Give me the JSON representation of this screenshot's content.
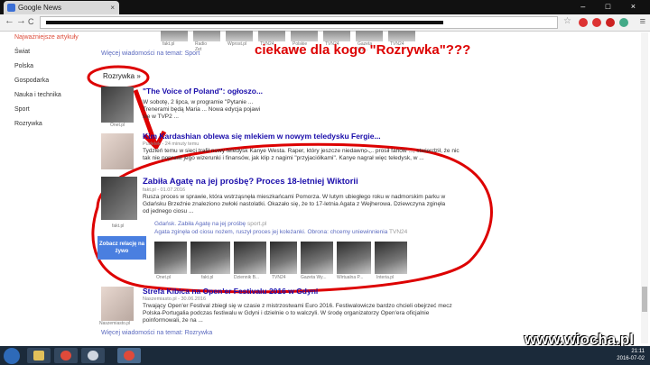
{
  "browser": {
    "tab_title": "Google News",
    "tab_close": "×",
    "window_controls": "– □ ×",
    "back": "←",
    "forward": "→",
    "reload": "C",
    "star": "☆",
    "menu": "≡"
  },
  "sidebar": {
    "items": [
      {
        "label": "Najważniejsze artykuły",
        "active": true
      },
      {
        "label": "Świat",
        "active": false
      },
      {
        "label": "Polska",
        "active": false
      },
      {
        "label": "Gospodarka",
        "active": false
      },
      {
        "label": "Nauka i technika",
        "active": false
      },
      {
        "label": "Sport",
        "active": false
      },
      {
        "label": "Rozrywka",
        "active": false
      }
    ]
  },
  "top_thumbs": {
    "captions": [
      "fakt.pl",
      "Radio Zet",
      "Wprost.pl",
      "TVN24",
      "Polskie Ra...",
      "TVN24",
      "Gazeta Wy...",
      "TVN24"
    ]
  },
  "sport_more": "Więcej wiadomości na temat: Sport",
  "section_label": "Rozrywka »",
  "annotation": "ciekawe dla  kogo \"Rozrywka\"???",
  "articles": [
    {
      "title": "\"The Voice of Poland\": ogłoszo...",
      "source": "",
      "body": "W sobotę, 2 lipca, w programie \"Pytanie ... Trenerami będą Maria ... Nowa edycja pojawi się w TVP2 ...",
      "thumb_caption": "Onet.pl"
    },
    {
      "title": "Kim Kardashian oblewa się mlekiem w nowym teledysku Fergie...",
      "source": "Pudelek - 24 minuty temu",
      "body": "Tydzień temu w sieci trafił nowy teledysk Kanye Westa. Raper, który jeszcze niedawno ... prosił fanów ..., stwierdził, że nic tak nie poprawi jego wizerunki i finansów, jak klip z nagimi \"przyjaciółkami\". Kanye nagrał więc teledysk, w ..."
    },
    {
      "title": "Zabiła Agatę na jej prośbę? Proces 18-letniej Wiktorii",
      "source": "fakt.pl - 01.07.2016",
      "body": "Rusza proces w sprawie, która wstrząsnęła mieszkańcami Pomorza. W lutym ubiegłego roku w nadmorskim parku w Gdańsku Brzeźnie znaleziono zwłoki nastolatki. Okazało się, że to 17-letnia Agata z Wejherowa. Dziewczyna zginęła od jednego ciosu ...",
      "thumb_caption": "fakt.pl",
      "live_button": "Zobacz relację na żywo",
      "related": [
        {
          "title": "Gdańsk. Zabiła Agatę na jej prośbę",
          "source": "sport.pl"
        },
        {
          "title": "Agata zginęła od ciosu nożem, ruszył proces jej koleżanki. Obrona: chcemy uniewinnienia",
          "source": "TVN24"
        }
      ],
      "photos": [
        "Onet.pl",
        "fakt.pl",
        "Dziennik B...",
        "TVN24",
        "Gazeta Wy...",
        "Wirtualna P...",
        "Interia.pl"
      ]
    },
    {
      "title": "Strefa Kibica na Open'er Festivalu 2016 w Gdyni",
      "source": "Naszemiasto.pl - 30.06.2016",
      "body": "Trwający Open'er Festival zbiegł się w czasie z mistrzostwami Euro 2016. Festiwalowicze bardzo chcieli obejrzeć mecz Polska-Portugalia podczas festiwalu w Gdyni i dzielnie o to walczyli. W środę organizatorzy Open'era oficjalnie poinformowali, że na ...",
      "thumb_caption": "Naszemiasto.pl"
    }
  ],
  "rozrywka_more": "Więcej wiadomości na temat: Rozrywka",
  "taskbar": {
    "time": "21:11",
    "date": "2016-07-02"
  },
  "watermark": "www.wiocha.pl",
  "colors": {
    "accent_red": "#dd0000",
    "link_blue": "#1a0dab"
  }
}
